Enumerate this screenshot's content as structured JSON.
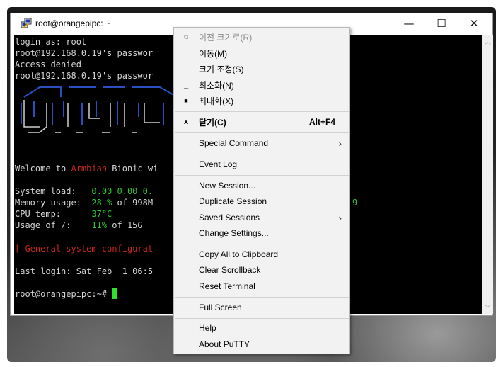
{
  "window": {
    "title": "root@orangepipc: ~",
    "min_symbol": "—",
    "max_symbol": "☐",
    "close_symbol": "✕",
    "icon": "putty-icon"
  },
  "terminal": {
    "lines": [
      "login as: root",
      "root@192.168.0.19's passwor",
      "Access denied",
      "root@192.168.0.19's passwor"
    ],
    "welcome_prefix": "Welcome to ",
    "welcome_brand": "Armbian",
    "welcome_suffix": " Bionic wi",
    "sysload_label": "System load:   ",
    "sysload_value": "0.00 0.00 0.",
    "mem_label": "Memory usage:  ",
    "mem_value": "28 %",
    "mem_rest": " of 998M",
    "mem_tail": "9",
    "cpu_label": "CPU temp:      ",
    "cpu_value": "37°C",
    "usage_label": "Usage of /:    ",
    "usage_value": "11%",
    "usage_rest": " of 15G",
    "config_line": "[ General system configurat",
    "last_login": "Last login: Sat Feb  1 06:5",
    "prompt": "root@orangepipc:~# "
  },
  "menu": {
    "restore": "이전 크기로(R)",
    "move": "이동(M)",
    "size": "크기 조정(S)",
    "minimize": "최소화(N)",
    "maximize": "최대화(X)",
    "close": "닫기(C)",
    "close_accel": "Alt+F4",
    "close_mark": "x",
    "special_command": "Special Command",
    "event_log": "Event Log",
    "new_session": "New Session...",
    "duplicate_session": "Duplicate Session",
    "saved_sessions": "Saved Sessions",
    "change_settings": "Change Settings...",
    "copy_all": "Copy All to Clipboard",
    "clear_scrollback": "Clear Scrollback",
    "reset_terminal": "Reset Terminal",
    "full_screen": "Full Screen",
    "help": "Help",
    "about": "About PuTTY",
    "submenu_arrow": "›"
  }
}
